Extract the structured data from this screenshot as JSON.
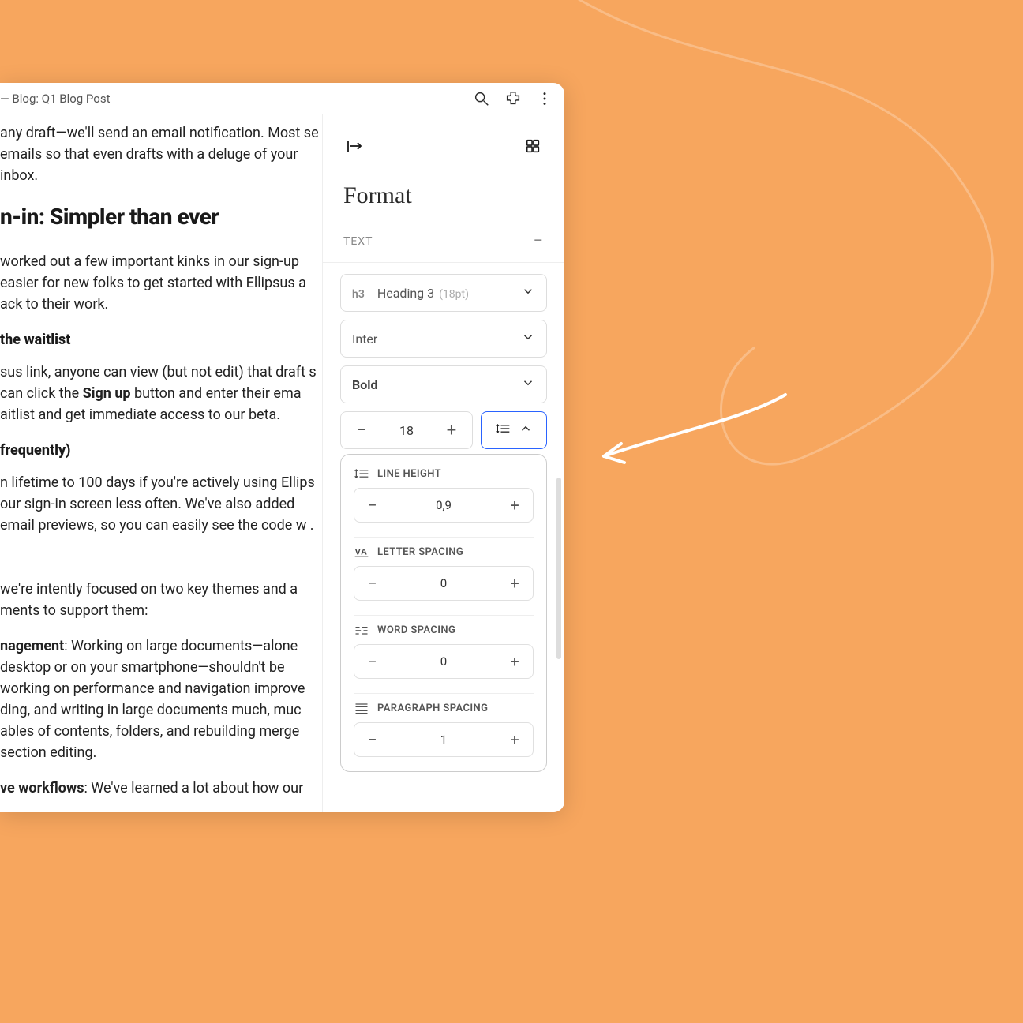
{
  "titlebar": {
    "title": " — Blog: Q1 Blog Post"
  },
  "document": {
    "p1": "any draft—we'll send an email notification. Most se emails so that even drafts with a deluge of your inbox.",
    "h2": "n-in: Simpler than ever",
    "p2": " worked out a few important kinks in our sign-up easier for new folks to get started with Ellipsus a ack to their work.",
    "h3a": "the waitlist",
    "p3a": "sus link, anyone can view (but not edit) that draft s can click the ",
    "p3_bold": "Sign up",
    "p3b": " button and enter their ema aitlist and get immediate access to our beta.",
    "h3b": " frequently)",
    "p4": "n lifetime to 100 days if you're actively using Ellips our sign-in screen less often. We've also added email previews, so you can easily see the code w .",
    "p5": "we're intently focused on two key themes and a ments to support them:",
    "p6_bold": "nagement",
    "p6": ": Working on large documents—alone desktop or on your smartphone—shouldn't be working on performance and navigation improve ding, and writing in large documents much, muc ables of contents, folders, and rebuilding merge section editing.",
    "p7_bold": "ve workflows",
    "p7": ": We've learned a lot about how our "
  },
  "panel": {
    "title": "Format",
    "section": "TEXT",
    "heading_select": {
      "prefix": "h3",
      "label": "Heading 3",
      "sub": "(18pt)"
    },
    "font_select": "Inter",
    "weight_select": "Bold",
    "size_value": "18",
    "spacing": {
      "line_height": {
        "label": "LINE HEIGHT",
        "value": "0,9"
      },
      "letter_spacing": {
        "label": "LETTER SPACING",
        "value": "0"
      },
      "word_spacing": {
        "label": "WORD SPACING",
        "value": "0"
      },
      "paragraph_spacing": {
        "label": "PARAGRAPH SPACING",
        "value": "1"
      }
    }
  }
}
